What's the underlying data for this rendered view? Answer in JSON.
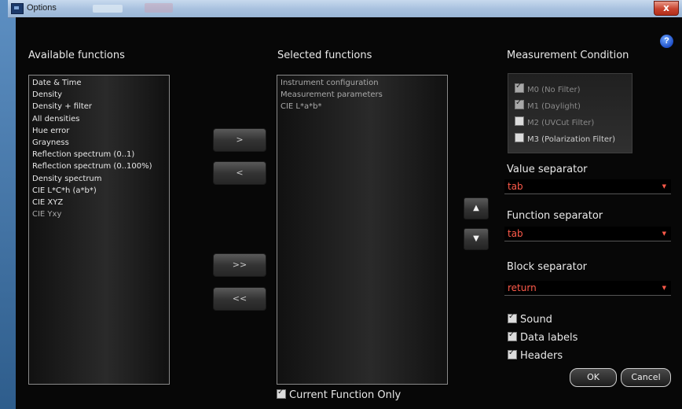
{
  "window": {
    "title": "Options",
    "close_label": "x",
    "help_label": "?"
  },
  "available": {
    "heading": "Available functions",
    "items": [
      "Date & Time",
      "Density",
      "Density + filter",
      "All densities",
      "Hue error",
      "Grayness",
      "Reflection spectrum (0..1)",
      "Reflection spectrum (0..100%)",
      "Density spectrum",
      "CIE L*C*h (a*b*)",
      "CIE XYZ",
      "CIE Yxy"
    ]
  },
  "selected": {
    "heading": "Selected functions",
    "items": [
      "Instrument configuration",
      "Measurement parameters",
      "CIE L*a*b*"
    ]
  },
  "buttons": {
    "add": ">",
    "remove": "<",
    "add_all": ">>",
    "remove_all": "<<",
    "up": "▲",
    "down": "▼",
    "ok": "OK",
    "cancel": "Cancel"
  },
  "measurement": {
    "heading": "Measurement Condition",
    "options": [
      {
        "label": "M0 (No Filter)",
        "checked": true
      },
      {
        "label": "M1 (Daylight)",
        "checked": true
      },
      {
        "label": "M2 (UVCut Filter)",
        "checked": false
      },
      {
        "label": "M3 (Polarization Filter)",
        "checked": false
      }
    ]
  },
  "value_separator": {
    "label": "Value separator",
    "value": "tab"
  },
  "function_separator": {
    "label": "Function separator",
    "value": "tab"
  },
  "block_separator": {
    "label": "Block separator",
    "value": "return"
  },
  "options": {
    "sound": "Sound",
    "data_labels": "Data labels",
    "headers": "Headers"
  },
  "current_function_only": "Current Function Only",
  "colors": {
    "accent_text": "#ff5a4a",
    "background": "#070707"
  }
}
